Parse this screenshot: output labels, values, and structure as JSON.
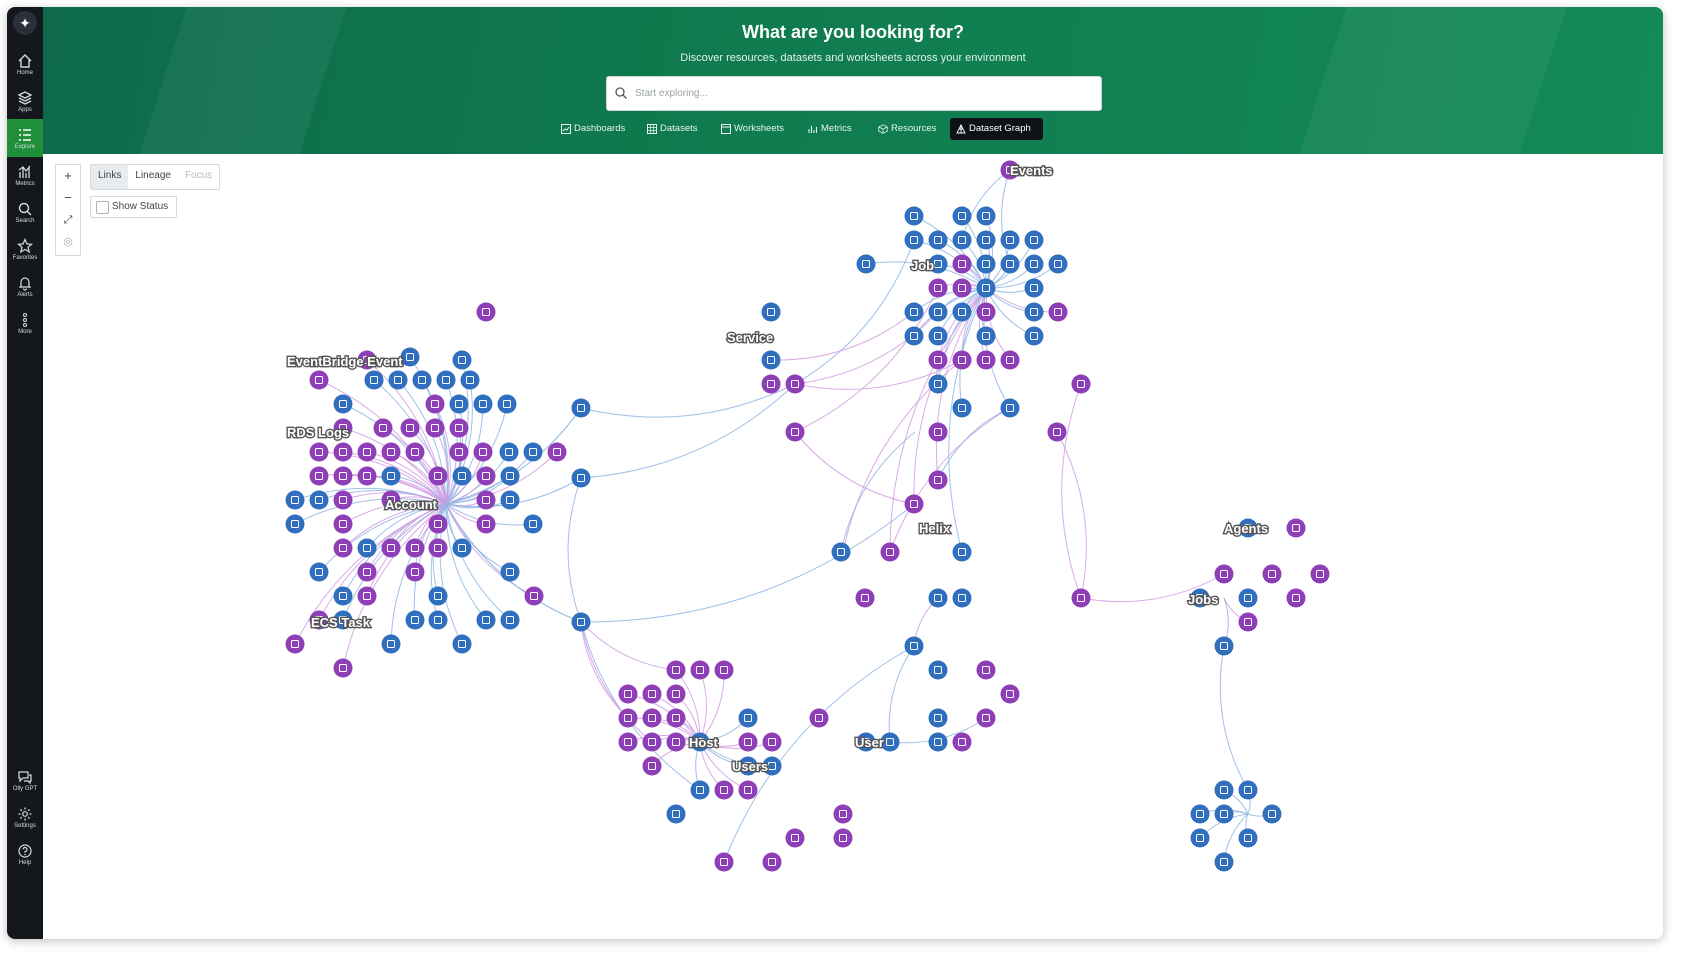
{
  "sidebar": {
    "items": [
      {
        "label": "Home",
        "icon": "home-icon"
      },
      {
        "label": "Apps",
        "icon": "apps-icon"
      },
      {
        "label": "Explore",
        "icon": "explore-icon",
        "active": true
      },
      {
        "label": "Metrics",
        "icon": "metrics-icon"
      },
      {
        "label": "Search",
        "icon": "search-icon"
      },
      {
        "label": "Favorites",
        "icon": "star-icon"
      },
      {
        "label": "Alerts",
        "icon": "bell-icon"
      },
      {
        "label": "More",
        "icon": "more-icon"
      }
    ],
    "bottom_items": [
      {
        "label": "Olly GPT",
        "icon": "chat-icon"
      },
      {
        "label": "Settings",
        "icon": "gear-icon"
      },
      {
        "label": "Help",
        "icon": "help-icon"
      }
    ]
  },
  "header": {
    "title": "What are you looking for?",
    "subtitle": "Discover resources, datasets and worksheets across your environment",
    "search_placeholder": "Start exploring...",
    "tabs": [
      {
        "label": "Dashboards",
        "icon": "dashboard-icon"
      },
      {
        "label": "Datasets",
        "icon": "grid-icon"
      },
      {
        "label": "Worksheets",
        "icon": "worksheet-icon"
      },
      {
        "label": "Metrics",
        "icon": "metrics-icon"
      },
      {
        "label": "Resources",
        "icon": "cube-icon"
      },
      {
        "label": "Dataset Graph",
        "icon": "graph-icon",
        "active": true
      }
    ]
  },
  "controls": {
    "zoom_in": "+",
    "zoom_out": "−",
    "fit": "⤢",
    "center": "◎",
    "modes": [
      "Links",
      "Lineage",
      "Focus"
    ],
    "selected_mode": "Links",
    "show_status": "Show Status"
  },
  "graph": {
    "colors": {
      "blue": "#2f6fbe",
      "purple": "#8e3fb8",
      "edge_blue": "#8fb6e3",
      "edge_purple": "#d39be3"
    },
    "labels": [
      "Events",
      "Job",
      "Service",
      "EventBridge Event",
      "RDS Logs",
      "Account",
      "ECS Task",
      "Helix",
      "Agents",
      "Jobs",
      "Host",
      "Users",
      "User"
    ]
  }
}
